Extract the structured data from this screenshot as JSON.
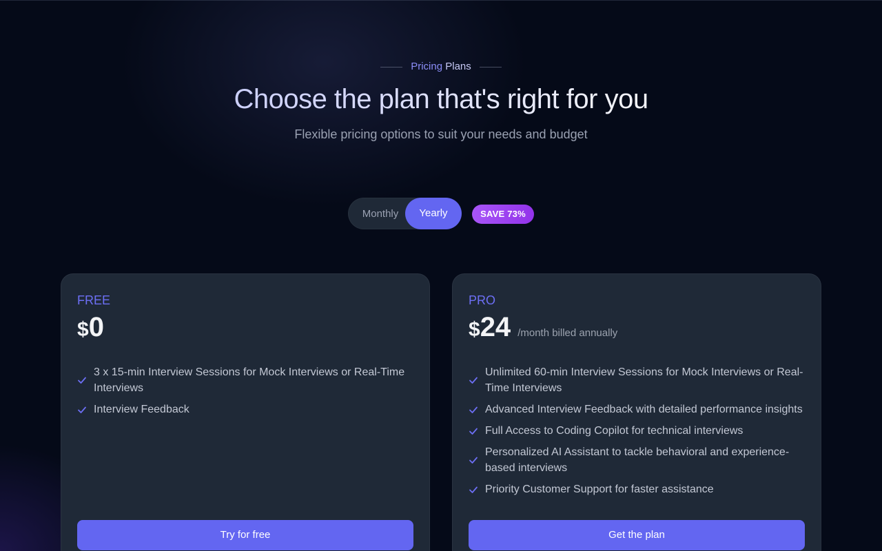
{
  "header": {
    "eyebrow_part1": "Pricing",
    "eyebrow_part2": "Plans",
    "title": "Choose the plan that's right for you",
    "subtitle": "Flexible pricing options to suit your needs and budget"
  },
  "billing_toggle": {
    "monthly_label": "Monthly",
    "yearly_label": "Yearly",
    "selected": "Yearly",
    "save_badge": "SAVE 73%"
  },
  "plans": [
    {
      "name": "FREE",
      "currency": "$",
      "price": "0",
      "period": "",
      "features": [
        "3 x 15-min Interview Sessions for Mock Interviews or Real-Time Interviews",
        "Interview Feedback"
      ],
      "cta_label": "Try for free"
    },
    {
      "name": "PRO",
      "currency": "$",
      "price": "24",
      "period": "/month billed annually",
      "features": [
        "Unlimited 60-min Interview Sessions for Mock Interviews or Real-Time Interviews",
        "Advanced Interview Feedback with detailed performance insights",
        "Full Access to Coding Copilot for technical interviews",
        "Personalized AI Assistant to tackle behavioral and experience-based interviews",
        "Priority Customer Support for faster assistance"
      ],
      "cta_label": "Get the plan"
    }
  ],
  "icons": {
    "feature_check": "check-icon"
  },
  "colors": {
    "accent": "#6366f1",
    "badge": "#a855f7",
    "card_bg": "#1f2937",
    "page_bg": "#050a18"
  }
}
